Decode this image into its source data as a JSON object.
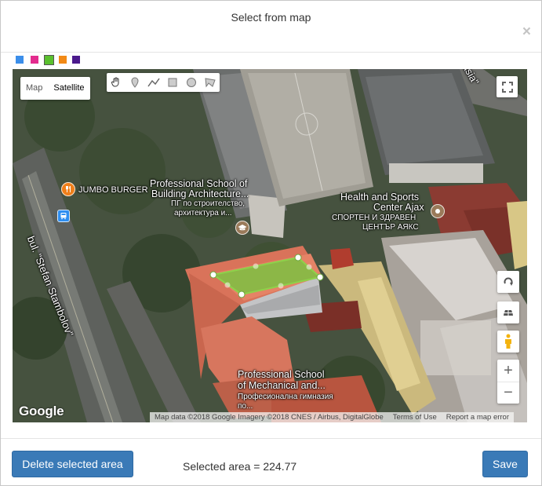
{
  "dialog": {
    "title": "Select from map",
    "close_symbol": "×"
  },
  "swatches": [
    {
      "color": "#3b8eea",
      "selected": false
    },
    {
      "color": "#e32c8e",
      "selected": false
    },
    {
      "color": "#5ac02e",
      "selected": true
    },
    {
      "color": "#f28a16",
      "selected": false
    },
    {
      "color": "#4b1a8c",
      "selected": false
    }
  ],
  "map": {
    "map_type": {
      "map_label": "Map",
      "satellite_label": "Satellite",
      "active": "Satellite"
    },
    "drawing_tools": [
      {
        "name": "hand-icon"
      },
      {
        "name": "marker-icon"
      },
      {
        "name": "polyline-icon"
      },
      {
        "name": "rectangle-icon"
      },
      {
        "name": "circle-icon"
      },
      {
        "name": "polygon-icon"
      }
    ],
    "labels": {
      "jumbo_burger": "JUMBO BURGER",
      "school_building_line1": "Professional School of",
      "school_building_line2": "Building Architecture...",
      "school_building_bg1": "ПГ по строителство,",
      "school_building_bg2": "архитектура и...",
      "health_line1": "Health and Sports",
      "health_line2": "Center Ajax",
      "health_bg1": "СПОРТЕН И ЗДРАВЕН",
      "health_bg2": "ЦЕНТЪР АЯКС",
      "school_mech_line1": "Professional School",
      "school_mech_line2": "of Mechanical and...",
      "school_mech_bg1": "Професионална гимназия",
      "school_mech_bg2": "по...",
      "street": "bul. \"Stefan Stambolov\"",
      "street_top": "asia\""
    },
    "zoom_in": "+",
    "zoom_out": "−",
    "google_logo": "Google",
    "attribution": {
      "data": "Map data ©2018 Google Imagery ©2018 CNES / Airbus, DigitalGlobe",
      "terms": "Terms of Use",
      "report": "Report a map error"
    },
    "selection_color": "#7cc142"
  },
  "footer": {
    "delete_label": "Delete selected area",
    "area_text": "Selected area = 224.77",
    "save_label": "Save"
  }
}
